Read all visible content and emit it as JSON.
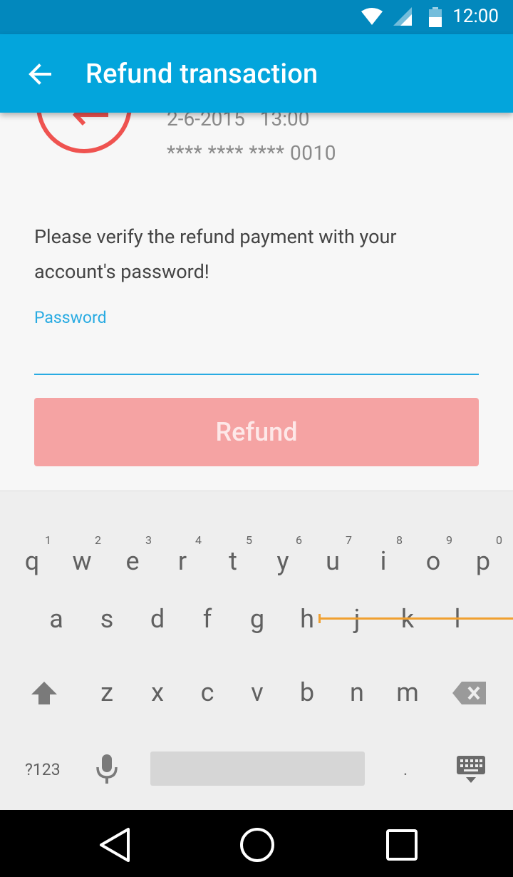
{
  "status": {
    "time": "12:00"
  },
  "app_bar": {
    "title": "Refund transaction"
  },
  "transaction": {
    "date": "2-6-2015   13:00",
    "card": "**** **** **** 0010"
  },
  "form": {
    "prompt": "Please verify the refund payment with your account's password!",
    "password_label": "Password",
    "refund_button": "Refund"
  },
  "keyboard": {
    "row1": [
      {
        "key": "q",
        "hint": "1"
      },
      {
        "key": "w",
        "hint": "2"
      },
      {
        "key": "e",
        "hint": "3"
      },
      {
        "key": "r",
        "hint": "4"
      },
      {
        "key": "t",
        "hint": "5"
      },
      {
        "key": "y",
        "hint": "6"
      },
      {
        "key": "u",
        "hint": "7"
      },
      {
        "key": "i",
        "hint": "8"
      },
      {
        "key": "o",
        "hint": "9"
      },
      {
        "key": "p",
        "hint": "0"
      }
    ],
    "row2": [
      "a",
      "s",
      "d",
      "f",
      "g",
      "h",
      "j",
      "k",
      "l"
    ],
    "row3": [
      "z",
      "x",
      "c",
      "v",
      "b",
      "n",
      "m"
    ],
    "symbols_key": "?123",
    "period_key": "."
  },
  "colors": {
    "status_bar": "#0288bd",
    "app_bar": "#03a5dc",
    "accent": "#29abe2",
    "refund_button": "#f5a3a3",
    "refund_icon": "#ef5350",
    "swipe_trail": "#f0a030"
  },
  "icons": {
    "status": [
      "wifi-icon",
      "cell-signal-icon",
      "battery-icon"
    ],
    "app_bar": "back-arrow-icon",
    "keyboard": [
      "shift-icon",
      "backspace-icon",
      "mic-icon",
      "keyboard-hide-icon"
    ],
    "nav": [
      "nav-back-icon",
      "nav-home-icon",
      "nav-recents-icon"
    ]
  }
}
